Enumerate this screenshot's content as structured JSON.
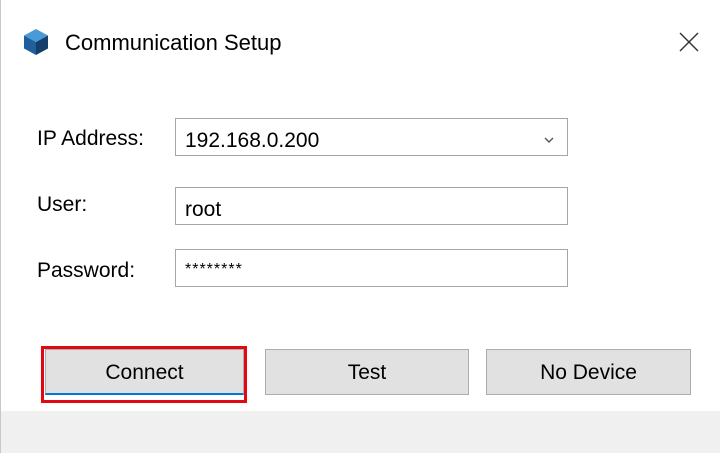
{
  "window": {
    "title": "Communication Setup",
    "app_icon": "cube-icon",
    "close_icon": "close-icon"
  },
  "form": {
    "ip_label": "IP Address:",
    "ip_value": "192.168.0.200",
    "user_label": "User:",
    "user_value": "root",
    "password_label": "Password:",
    "password_value": "********"
  },
  "buttons": {
    "connect": "Connect",
    "test": "Test",
    "no_device": "No Device"
  },
  "colors": {
    "highlight": "#e30613",
    "focus_underline": "#0078d7",
    "icon_blue": "#1f6fb2"
  }
}
